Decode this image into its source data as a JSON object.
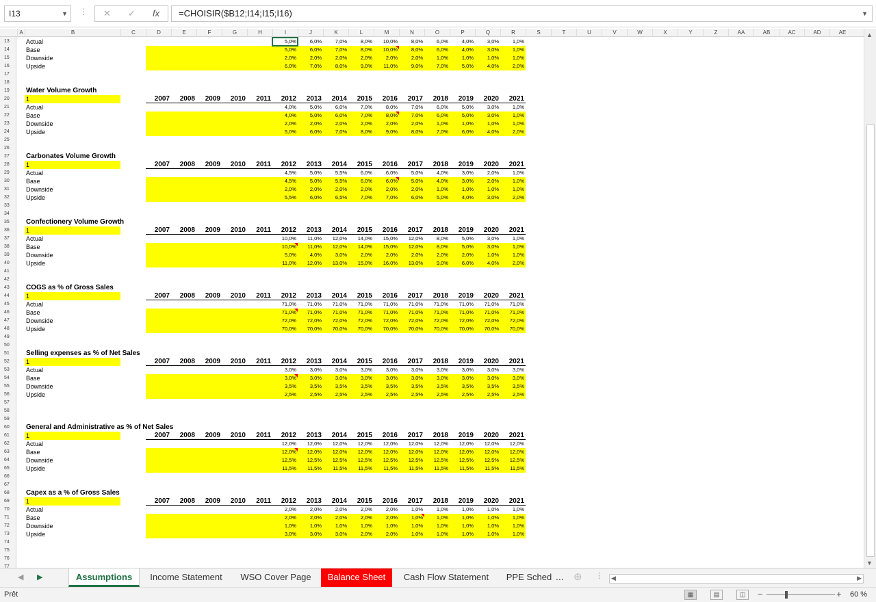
{
  "formula_bar": {
    "name_box": "I13",
    "formula": "=CHOISIR($B12;I14;I15;I16)"
  },
  "columns": [
    "A",
    "B",
    "C",
    "D",
    "E",
    "F",
    "G",
    "H",
    "I",
    "J",
    "K",
    "L",
    "M",
    "N",
    "O",
    "P",
    "Q",
    "R",
    "S",
    "T",
    "U",
    "V",
    "W",
    "X",
    "Y",
    "Z",
    "AA",
    "AB",
    "AC",
    "AD",
    "AE"
  ],
  "years": [
    "2007",
    "2008",
    "2009",
    "2010",
    "2011",
    "2012",
    "2013",
    "2014",
    "2015",
    "2016",
    "2017",
    "2018",
    "2019",
    "2020",
    "2021"
  ],
  "scenario_labels": [
    "Actual",
    "Base",
    "Downside",
    "Upside"
  ],
  "selector_value": "1",
  "top_block": {
    "Actual": [
      "5,0%",
      "6,0%",
      "7,0%",
      "8,0%",
      "10,0%",
      "8,0%",
      "6,0%",
      "4,0%",
      "3,0%",
      "1,0%"
    ],
    "Base": [
      "5,0%",
      "6,0%",
      "7,0%",
      "8,0%",
      "10,0%",
      "8,0%",
      "6,0%",
      "4,0%",
      "3,0%",
      "1,0%"
    ],
    "Downside": [
      "2,0%",
      "2,0%",
      "2,0%",
      "2,0%",
      "2,0%",
      "2,0%",
      "1,0%",
      "1,0%",
      "1,0%",
      "1,0%"
    ],
    "Upside": [
      "6,0%",
      "7,0%",
      "8,0%",
      "9,0%",
      "11,0%",
      "9,0%",
      "7,0%",
      "5,0%",
      "4,0%",
      "2,0%"
    ]
  },
  "sections": [
    {
      "title": "Water Volume Growth",
      "Actual": [
        "4,0%",
        "5,0%",
        "6,0%",
        "7,0%",
        "8,0%",
        "7,0%",
        "6,0%",
        "5,0%",
        "3,0%",
        "1,0%"
      ],
      "Base": [
        "4,0%",
        "5,0%",
        "6,0%",
        "7,0%",
        "8,0%",
        "7,0%",
        "6,0%",
        "5,0%",
        "3,0%",
        "1,0%"
      ],
      "Downside": [
        "2,0%",
        "2,0%",
        "2,0%",
        "2,0%",
        "2,0%",
        "2,0%",
        "1,0%",
        "1,0%",
        "1,0%",
        "1,0%"
      ],
      "Upside": [
        "5,0%",
        "6,0%",
        "7,0%",
        "8,0%",
        "9,0%",
        "8,0%",
        "7,0%",
        "6,0%",
        "4,0%",
        "2,0%"
      ]
    },
    {
      "title": "Carbonates Volume Growth",
      "Actual": [
        "4,5%",
        "5,0%",
        "5,5%",
        "6,0%",
        "6,0%",
        "5,0%",
        "4,0%",
        "3,0%",
        "2,0%",
        "1,0%"
      ],
      "Base": [
        "4,5%",
        "5,0%",
        "5,5%",
        "6,0%",
        "6,0%",
        "5,0%",
        "4,0%",
        "3,0%",
        "2,0%",
        "1,0%"
      ],
      "Downside": [
        "2,0%",
        "2,0%",
        "2,0%",
        "2,0%",
        "2,0%",
        "2,0%",
        "1,0%",
        "1,0%",
        "1,0%",
        "1,0%"
      ],
      "Upside": [
        "5,5%",
        "6,0%",
        "6,5%",
        "7,0%",
        "7,0%",
        "6,0%",
        "5,0%",
        "4,0%",
        "3,0%",
        "2,0%"
      ]
    },
    {
      "title": "Confectionery Volume Growth",
      "Actual": [
        "10,0%",
        "11,0%",
        "12,0%",
        "14,0%",
        "15,0%",
        "12,0%",
        "8,0%",
        "5,0%",
        "3,0%",
        "1,0%"
      ],
      "Base": [
        "10,0%",
        "11,0%",
        "12,0%",
        "14,0%",
        "15,0%",
        "12,0%",
        "8,0%",
        "5,0%",
        "3,0%",
        "1,0%"
      ],
      "Downside": [
        "5,0%",
        "4,0%",
        "3,0%",
        "2,0%",
        "2,0%",
        "2,0%",
        "2,0%",
        "2,0%",
        "1,0%",
        "1,0%"
      ],
      "Upside": [
        "11,0%",
        "12,0%",
        "13,0%",
        "15,0%",
        "16,0%",
        "13,0%",
        "9,0%",
        "6,0%",
        "4,0%",
        "2,0%"
      ]
    },
    {
      "title": "COGS as % of Gross Sales",
      "Actual": [
        "71,0%",
        "71,0%",
        "71,0%",
        "71,0%",
        "71,0%",
        "71,0%",
        "71,0%",
        "71,0%",
        "71,0%",
        "71,0%"
      ],
      "Base": [
        "71,0%",
        "71,0%",
        "71,0%",
        "71,0%",
        "71,0%",
        "71,0%",
        "71,0%",
        "71,0%",
        "71,0%",
        "71,0%"
      ],
      "Downside": [
        "72,0%",
        "72,0%",
        "72,0%",
        "72,0%",
        "72,0%",
        "72,0%",
        "72,0%",
        "72,0%",
        "72,0%",
        "72,0%"
      ],
      "Upside": [
        "70,0%",
        "70,0%",
        "70,0%",
        "70,0%",
        "70,0%",
        "70,0%",
        "70,0%",
        "70,0%",
        "70,0%",
        "70,0%"
      ]
    },
    {
      "title": "Selling expenses as % of Net Sales",
      "Actual": [
        "3,0%",
        "3,0%",
        "3,0%",
        "3,0%",
        "3,0%",
        "3,0%",
        "3,0%",
        "3,0%",
        "3,0%",
        "3,0%"
      ],
      "Base": [
        "3,0%",
        "3,0%",
        "3,0%",
        "3,0%",
        "3,0%",
        "3,0%",
        "3,0%",
        "3,0%",
        "3,0%",
        "3,0%"
      ],
      "Downside": [
        "3,5%",
        "3,5%",
        "3,5%",
        "3,5%",
        "3,5%",
        "3,5%",
        "3,5%",
        "3,5%",
        "3,5%",
        "3,5%"
      ],
      "Upside": [
        "2,5%",
        "2,5%",
        "2,5%",
        "2,5%",
        "2,5%",
        "2,5%",
        "2,5%",
        "2,5%",
        "2,5%",
        "2,5%"
      ]
    },
    {
      "title": "General and Administrative as % of Net Sales",
      "Actual": [
        "12,0%",
        "12,0%",
        "12,0%",
        "12,0%",
        "12,0%",
        "12,0%",
        "12,0%",
        "12,0%",
        "12,0%",
        "12,0%"
      ],
      "Base": [
        "12,0%",
        "12,0%",
        "12,0%",
        "12,0%",
        "12,0%",
        "12,0%",
        "12,0%",
        "12,0%",
        "12,0%",
        "12,0%"
      ],
      "Downside": [
        "12,5%",
        "12,5%",
        "12,5%",
        "12,5%",
        "12,5%",
        "12,5%",
        "12,5%",
        "12,5%",
        "12,5%",
        "12,5%"
      ],
      "Upside": [
        "11,5%",
        "11,5%",
        "11,5%",
        "11,5%",
        "11,5%",
        "11,5%",
        "11,5%",
        "11,5%",
        "11,5%",
        "11,5%"
      ]
    },
    {
      "title": "Capex as a % of Gross Sales",
      "Actual": [
        "2,0%",
        "2,0%",
        "2,0%",
        "2,0%",
        "2,0%",
        "1,0%",
        "1,0%",
        "1,0%",
        "1,0%",
        "1,0%"
      ],
      "Base": [
        "2,0%",
        "2,0%",
        "2,0%",
        "2,0%",
        "2,0%",
        "1,0%",
        "1,0%",
        "1,0%",
        "1,0%",
        "1,0%"
      ],
      "Downside": [
        "1,0%",
        "1,0%",
        "1,0%",
        "1,0%",
        "1,0%",
        "1,0%",
        "1,0%",
        "1,0%",
        "1,0%",
        "1,0%"
      ],
      "Upside": [
        "3,0%",
        "3,0%",
        "3,0%",
        "2,0%",
        "2,0%",
        "1,0%",
        "1,0%",
        "1,0%",
        "1,0%",
        "1,0%"
      ]
    }
  ],
  "tabs": [
    "Assumptions",
    "Income Statement",
    "WSO Cover Page",
    "Balance Sheet",
    "Cash Flow Statement",
    "PPE Sched"
  ],
  "tab_overflow": "...",
  "status": "Prêt",
  "zoom": "60 %",
  "colors": {
    "highlight": "#ffff00",
    "tab_red": "#ff0000",
    "excel_green": "#217346"
  }
}
